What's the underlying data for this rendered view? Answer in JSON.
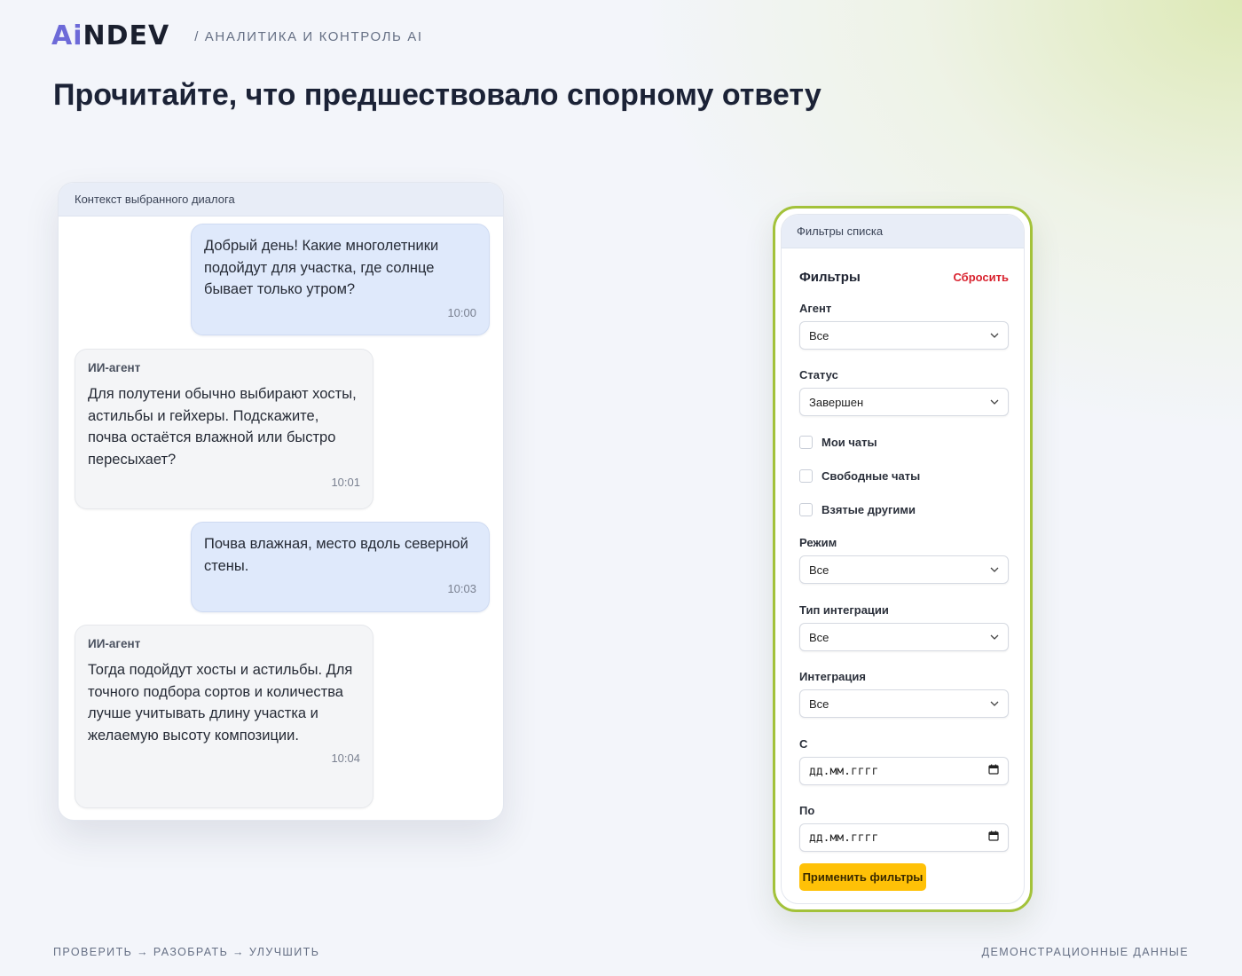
{
  "brand": {
    "logo_prefix": "Ai",
    "logo_suffix": "NDEV",
    "tagline": "/ Аналитика и контроль AI"
  },
  "page_title": "Прочитайте, что предшествовало спорному ответу",
  "chat": {
    "header": "Контекст выбранного диалога",
    "messages": [
      {
        "role": "user",
        "text": "Добрый день! Какие многолетники подойдут для участка, где солнце бывает только утром?",
        "time": "10:00"
      },
      {
        "role": "agent",
        "author": "ИИ-агент",
        "text": "Для полутени обычно выбирают хосты, астильбы и гейхеры. Подскажите, почва остаётся влажной или быстро пересыхает?",
        "time": "10:01"
      },
      {
        "role": "user",
        "text": "Почва влажная, место вдоль северной стены.",
        "time": "10:03"
      },
      {
        "role": "agent",
        "author": "ИИ-агент",
        "text": "Тогда подойдут хосты и астильбы. Для точного подбора сортов и количества лучше учитывать длину участка и желаемую высоту композиции.",
        "time": "10:04"
      }
    ]
  },
  "filters": {
    "panel_header": "Фильтры списка",
    "title": "Фильтры",
    "reset_label": "Сбросить",
    "agent": {
      "label": "Агент",
      "value": "Все"
    },
    "status": {
      "label": "Статус",
      "value": "Завершен"
    },
    "checkboxes": [
      {
        "label": "Мои чаты",
        "checked": false
      },
      {
        "label": "Свободные чаты",
        "checked": false
      },
      {
        "label": "Взятые другими",
        "checked": false
      }
    ],
    "mode": {
      "label": "Режим",
      "value": "Все"
    },
    "integration_type": {
      "label": "Тип интеграции",
      "value": "Все"
    },
    "integration": {
      "label": "Интеграция",
      "value": "Все"
    },
    "date_from": {
      "label": "С",
      "placeholder": "дд.мм.гггг"
    },
    "date_to": {
      "label": "По",
      "placeholder": "дд.мм.гггг"
    },
    "apply_label": "Применить фильтры"
  },
  "footer": {
    "left": "Проверить → разобрать → улучшить",
    "right": "Демонстрационные данные"
  },
  "colors": {
    "accent_green": "#a3c23a",
    "apply_yellow": "#ffc107",
    "reset_red": "#d9232f",
    "user_bubble": "#dfe9fb",
    "agent_bubble": "#f4f5f7",
    "logo_purple": "#6d6ad8"
  }
}
